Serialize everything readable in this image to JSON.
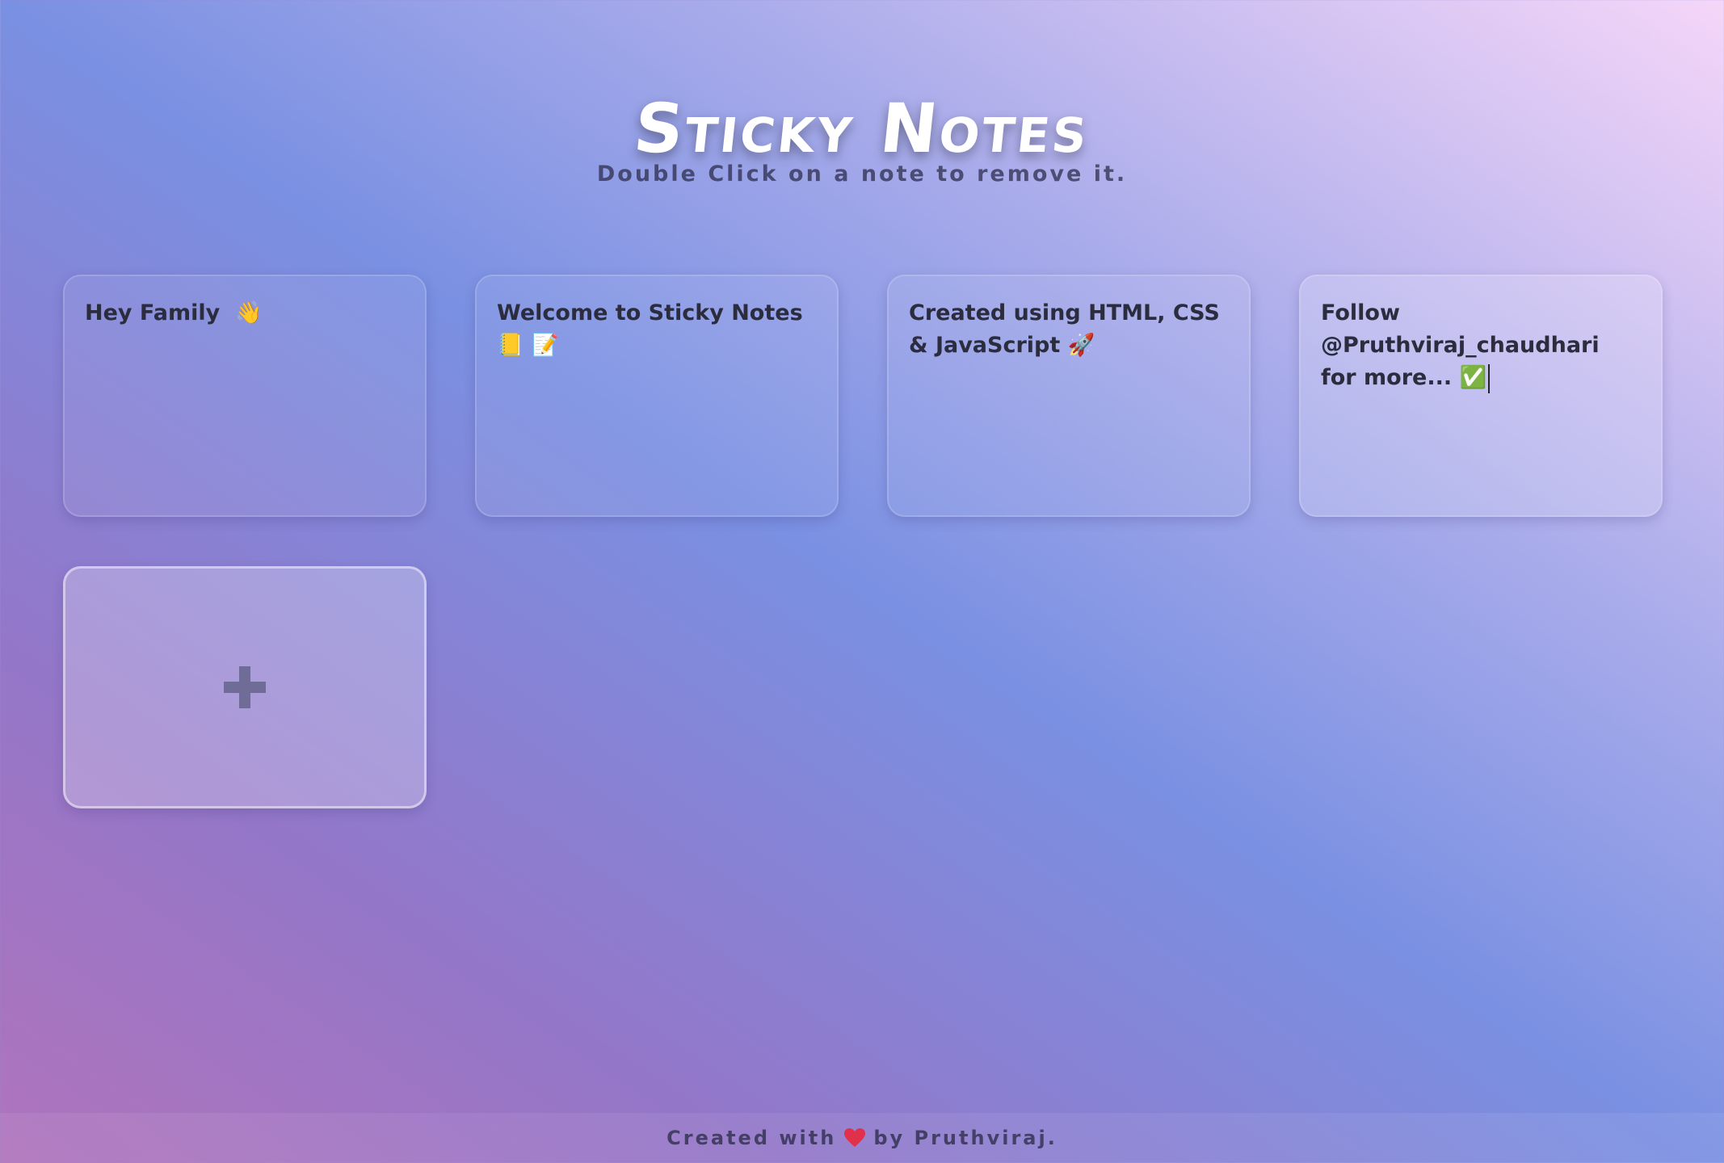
{
  "header": {
    "title": "Sticky Notes",
    "subtitle": "Double Click on a note to remove it."
  },
  "notes": [
    {
      "text": "Hey Family  👋"
    },
    {
      "text": "Welcome to Sticky Notes 📒 📝"
    },
    {
      "text": "Created using HTML, CSS & JavaScript 🚀"
    },
    {
      "text": "Follow @Pruthviraj_chaudhari for more... ✅"
    }
  ],
  "add_button": {
    "icon": "plus-icon"
  },
  "footer": {
    "prefix": "Created with",
    "heart_icon": "heart-icon",
    "suffix": "by Pruthviraj."
  },
  "colors": {
    "gradient_bottom_left": "#b074bc",
    "gradient_middle": "#7a90e2",
    "gradient_top_right": "#f5d6f8",
    "heart": "#e0304a"
  }
}
